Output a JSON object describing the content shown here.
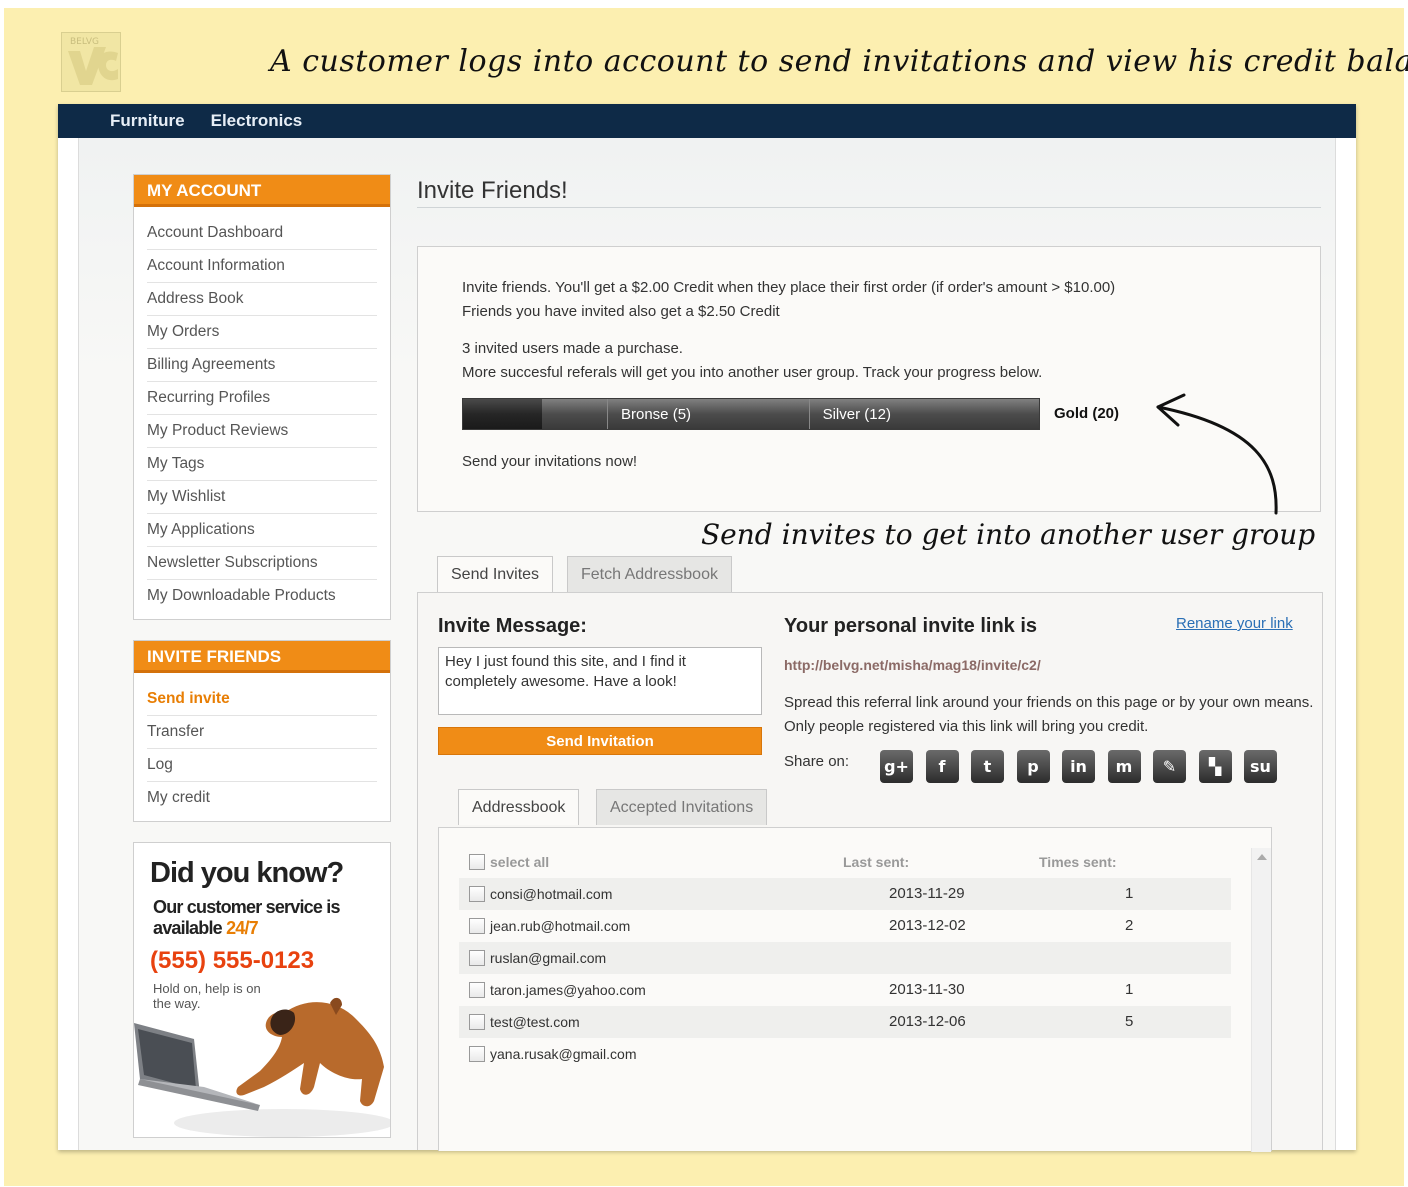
{
  "banner": {
    "logo_text": "BELVG",
    "title": "A customer logs into account to send invitations and view his credit balance",
    "note": "Send invites to get into another user group"
  },
  "topnav": [
    "Furniture",
    "Electronics"
  ],
  "sidebar": {
    "account_title": "MY ACCOUNT",
    "account_items": [
      "Account Dashboard",
      "Account Information",
      "Address Book",
      "My Orders",
      "Billing Agreements",
      "Recurring Profiles",
      "My Product Reviews",
      "My Tags",
      "My Wishlist",
      "My Applications",
      "Newsletter Subscriptions",
      "My Downloadable Products"
    ],
    "invite_title": "INVITE FRIENDS",
    "invite_items": [
      "Send invite",
      "Transfer",
      "Log",
      "My credit"
    ],
    "active_invite_item": "Send invite"
  },
  "promo": {
    "heading": "Did you know?",
    "sub_line1": "Our customer service is",
    "sub_line2": "available",
    "sub_hours": "24/7",
    "phone": "(555) 555-0123",
    "hold": "Hold on, help is on the way."
  },
  "main": {
    "title": "Invite Friends!",
    "info_line1": "Invite friends. You'll get a $2.00 Credit when they place their first order (if order's amount > $10.00)",
    "info_line2": "Friends you have invited also get a $2.50 Credit",
    "purchases": "3 invited users made a purchase.",
    "progress_text": "More succesful referals will get you into another user group. Track your progress below.",
    "progress": {
      "current": 3,
      "max": 20,
      "tiers": [
        {
          "label": "Bronse (5)",
          "threshold": 5
        },
        {
          "label": "Silver (12)",
          "threshold": 12
        },
        {
          "label": "Gold (20)",
          "threshold": 20
        }
      ]
    },
    "cta": "Send your invitations now!"
  },
  "tabs": {
    "top": [
      "Send Invites",
      "Fetch Addressbook"
    ],
    "bottom": [
      "Addressbook",
      "Accepted Invitations"
    ]
  },
  "invite": {
    "heading": "Invite Message:",
    "message": "Hey I just found this site, and I find it completely awesome. Have a look!",
    "send_button": "Send Invitation"
  },
  "link": {
    "heading": "Your personal invite link is",
    "rename": "Rename your link",
    "url": "http://belvg.net/misha/mag18/invite/c2/",
    "description": "Spread this referral link around your friends on this page or by your own means. Only people registered via this link will bring you credit.",
    "share_label": "Share on:",
    "share_icons": [
      "google-plus-icon",
      "facebook-icon",
      "twitter-icon",
      "pinterest-icon",
      "linkedin-icon",
      "myspace-icon",
      "blogger-icon",
      "delicious-icon",
      "stumbleupon-icon"
    ],
    "share_glyphs": [
      "g+",
      "f",
      "t",
      "p",
      "in",
      "m",
      "✎",
      "▚",
      "su"
    ]
  },
  "addressbook": {
    "select_all": "select all",
    "col_last_sent": "Last sent:",
    "col_times_sent": "Times sent:",
    "rows": [
      {
        "email": "consi@hotmail.com",
        "last_sent": "2013-11-29",
        "times": "1"
      },
      {
        "email": "jean.rub@hotmail.com",
        "last_sent": "2013-12-02",
        "times": "2"
      },
      {
        "email": "ruslan@gmail.com",
        "last_sent": "",
        "times": ""
      },
      {
        "email": "taron.james@yahoo.com",
        "last_sent": "2013-11-30",
        "times": "1"
      },
      {
        "email": "test@test.com",
        "last_sent": "2013-12-06",
        "times": "5"
      },
      {
        "email": "yana.rusak@gmail.com",
        "last_sent": "",
        "times": ""
      }
    ]
  }
}
